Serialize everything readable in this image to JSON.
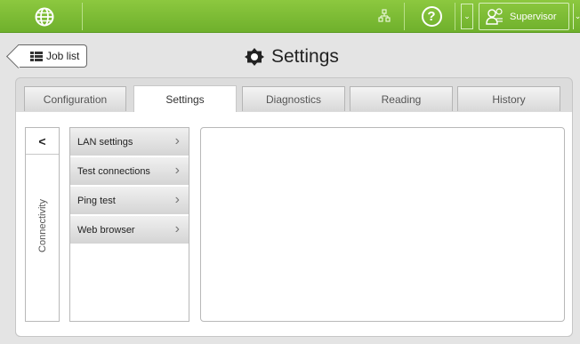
{
  "topbar": {
    "globe_icon": "globe-icon",
    "network_icon": "network-icon",
    "help_label": "?",
    "user_icon": "user-icon",
    "user_label": "Supervisor",
    "chevron": "⌄"
  },
  "header": {
    "back_label": "Job list",
    "back_icon": "grid-icon",
    "title": "Settings",
    "title_icon": "gear-icon"
  },
  "tabs": [
    {
      "label": "Configuration",
      "active": false
    },
    {
      "label": "Settings",
      "active": true
    },
    {
      "label": "Diagnostics",
      "active": false
    },
    {
      "label": "Reading",
      "active": false
    },
    {
      "label": "History",
      "active": false
    }
  ],
  "sidebar": {
    "back_glyph": "<",
    "section_label": "Connectivity"
  },
  "menu": {
    "items": [
      {
        "label": "LAN settings"
      },
      {
        "label": "Test connections"
      },
      {
        "label": "Ping test"
      },
      {
        "label": "Web browser"
      }
    ],
    "chevron": "›"
  },
  "colors": {
    "topbar_green": "#7cbc35",
    "panel_gray": "#dcdcdc",
    "tab_active": "#ffffff"
  }
}
